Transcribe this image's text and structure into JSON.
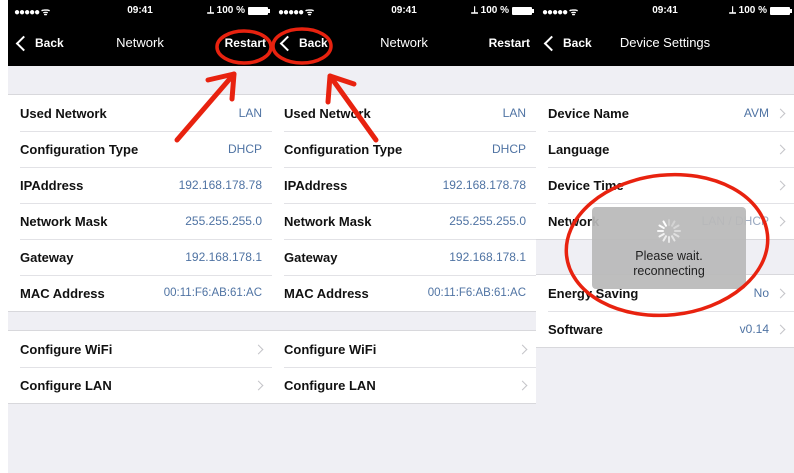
{
  "colors": {
    "annotation": "#e8220f",
    "value_blue": "#4f73a3",
    "bar": "#000000",
    "background": "#efeff4"
  },
  "screens": [
    {
      "status": {
        "signal": "●●●●● ᯤ",
        "time": "09:41",
        "battery": "⟂ 100 %"
      },
      "nav": {
        "back": "Back",
        "title": "Network",
        "right": "Restart"
      },
      "group1": [
        {
          "label": "Used Network",
          "value": "LAN"
        },
        {
          "label": "Configuration Type",
          "value": "DHCP"
        },
        {
          "label": "IPAddress",
          "value": "192.168.178.78"
        },
        {
          "label": "Network Mask",
          "value": "255.255.255.0"
        },
        {
          "label": "Gateway",
          "value": "192.168.178.1"
        },
        {
          "label": "MAC Address",
          "value": "00:11:F6:AB:61:AC"
        }
      ],
      "group2": [
        {
          "label": "Configure WiFi"
        },
        {
          "label": "Configure LAN"
        }
      ]
    },
    {
      "status": {
        "signal": "●●●●● ᯤ",
        "time": "09:41",
        "battery": "⟂ 100 %"
      },
      "nav": {
        "back": "Back",
        "title": "Network",
        "right": "Restart"
      },
      "group1": [
        {
          "label": "Used Network",
          "value": "LAN"
        },
        {
          "label": "Configuration Type",
          "value": "DHCP"
        },
        {
          "label": "IPAddress",
          "value": "192.168.178.78"
        },
        {
          "label": "Network Mask",
          "value": "255.255.255.0"
        },
        {
          "label": "Gateway",
          "value": "192.168.178.1"
        },
        {
          "label": "MAC Address",
          "value": "00:11:F6:AB:61:AC"
        }
      ],
      "group2": [
        {
          "label": "Configure WiFi"
        },
        {
          "label": "Configure LAN"
        }
      ]
    },
    {
      "status": {
        "signal": "●●●●● ᯤ",
        "time": "09:41",
        "battery": "⟂ 100 %"
      },
      "nav": {
        "back": "Back",
        "title": "Device Settings"
      },
      "group1": [
        {
          "label": "Device Name",
          "value": "AVM"
        },
        {
          "label": "Language",
          "value": ""
        },
        {
          "label": "Device Time",
          "value": ""
        },
        {
          "label": "Network",
          "value": "LAN / DHCP"
        }
      ],
      "group2": [
        {
          "label": "Energy Saving",
          "value": "No"
        },
        {
          "label": "Software",
          "value": "v0.14"
        }
      ]
    }
  ],
  "hud": {
    "line1": "Please wait.",
    "line2": "reconnecting"
  }
}
